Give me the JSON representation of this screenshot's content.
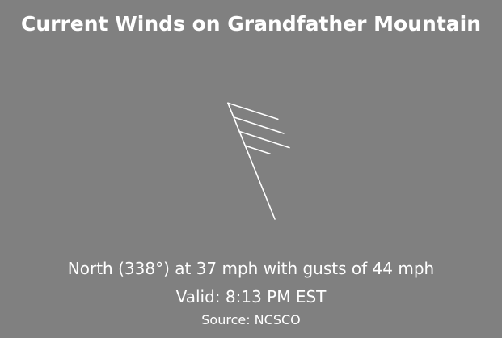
{
  "title": "Current Winds on Grandfather Mountain",
  "wind": {
    "direction_deg": 338,
    "speed_mph": 37,
    "gust_mph": 44,
    "barb": {
      "full_barbs": 3,
      "half_barbs": 1
    },
    "summary": "North (338°) at 37 mph with gusts of 44 mph"
  },
  "valid": "Valid: 8:13 PM EST",
  "source": "Source: NCSCO",
  "colors": {
    "background": "#808080",
    "foreground": "#ffffff"
  }
}
